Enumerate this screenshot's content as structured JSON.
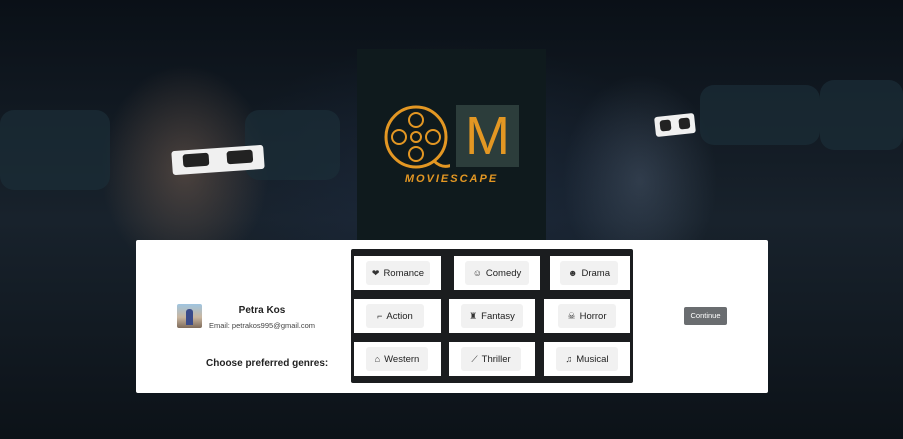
{
  "brand": {
    "logo_letter": "M",
    "logo_text": "MOVIESCAPE",
    "accent_color": "#e39723"
  },
  "user": {
    "name": "Petra Kos",
    "email": "Email: petrakos995@gmail.com"
  },
  "genre_prompt": "Choose preferred genres:",
  "genres": [
    {
      "label": "Romance",
      "icon": "heart-icon"
    },
    {
      "label": "Comedy",
      "icon": "comedy-mask-icon"
    },
    {
      "label": "Drama",
      "icon": "drama-masks-icon"
    },
    {
      "label": "Action",
      "icon": "gun-icon"
    },
    {
      "label": "Fantasy",
      "icon": "castle-icon"
    },
    {
      "label": "Horror",
      "icon": "skull-icon"
    },
    {
      "label": "Western",
      "icon": "cowboy-hat-icon"
    },
    {
      "label": "Thriller",
      "icon": "knife-icon"
    },
    {
      "label": "Musical",
      "icon": "music-note-icon"
    }
  ],
  "continue_label": "Continue"
}
